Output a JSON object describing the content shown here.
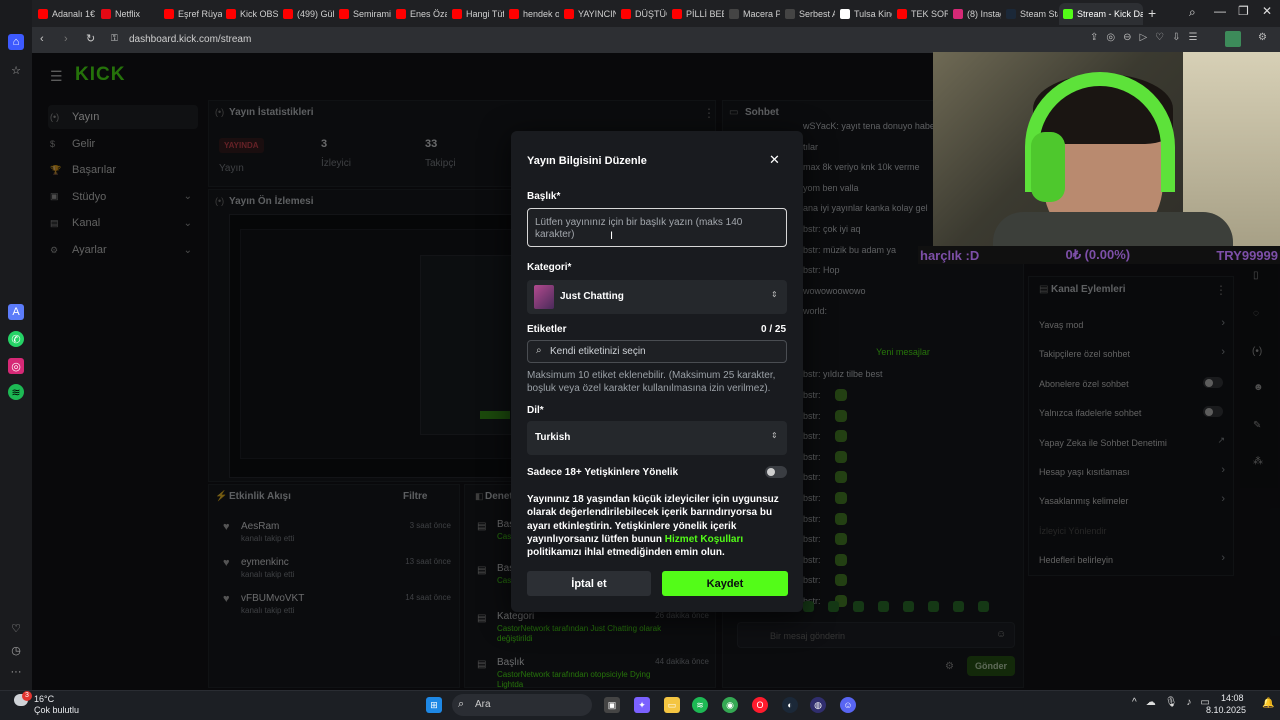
{
  "browser": {
    "tabs": [
      {
        "label": "Adanalı 1€",
        "color": "#ff0000"
      },
      {
        "label": "Netflix",
        "color": "#e50914"
      },
      {
        "label": "Eşref Rüya",
        "color": "#ff0000"
      },
      {
        "label": "Kick OBS",
        "color": "#ff0000"
      },
      {
        "label": "(499) Gülü",
        "color": "#ff0000"
      },
      {
        "label": "Semiramis",
        "color": "#ff0000"
      },
      {
        "label": "Enes Özay",
        "color": "#ff0000"
      },
      {
        "label": "Hangi Tüfe",
        "color": "#ff0000"
      },
      {
        "label": "hendek oy",
        "color": "#ff0000"
      },
      {
        "label": "YAYINCINI",
        "color": "#ff0000"
      },
      {
        "label": "DÜŞTÜĞÜ",
        "color": "#ff0000"
      },
      {
        "label": "PİLLİ BEBE",
        "color": "#ff0000"
      },
      {
        "label": "Macera Pe",
        "color": "#444444"
      },
      {
        "label": "Serbest At",
        "color": "#444444"
      },
      {
        "label": "Tulsa King",
        "color": "#ffffff"
      },
      {
        "label": "TEK SORU",
        "color": "#ff0000"
      },
      {
        "label": "(8) Instagr",
        "color": "#d62976"
      },
      {
        "label": "Steam Sta",
        "color": "#1b2838"
      },
      {
        "label": "Stream - Kick Da",
        "color": "#53fc18"
      }
    ],
    "url": "dashboard.kick.com/stream"
  },
  "app": {
    "logo": "KICK",
    "nav": [
      {
        "label": "Yayın",
        "active": true
      },
      {
        "label": "Gelir"
      },
      {
        "label": "Başarılar"
      },
      {
        "label": "Stüdyo",
        "chevron": true
      },
      {
        "label": "Kanal",
        "chevron": true
      },
      {
        "label": "Ayarlar",
        "chevron": true
      }
    ],
    "stats": {
      "title": "Yayın İstatistikleri",
      "badge": "YAYINDA",
      "badge_caption": "Yayın",
      "viewers_value": "3",
      "viewers_label": "İzleyici",
      "followers_value": "33",
      "followers_label": "Takipçi"
    },
    "preview_title": "Yayın Ön İzlemesi",
    "activity": {
      "title": "Etkinlik Akışı",
      "filter": "Filtre",
      "items": [
        {
          "name": "AesRam",
          "sub": "kanalı takip etti",
          "time": "3 saat önce"
        },
        {
          "name": "eymenkinc",
          "sub": "kanalı takip etti",
          "time": "13 saat önce"
        },
        {
          "name": "vFBUMvoVKT",
          "sub": "kanalı takip etti",
          "time": "14 saat önce"
        }
      ]
    },
    "events": {
      "title": "Denet",
      "items": [
        {
          "label": "Baş",
          "sub": "Cas"
        },
        {
          "label": "Baş",
          "sub": "Cas"
        },
        {
          "label": "Kategori",
          "sub": "CastorNetwork tarafından Just Chatting olarak değiştirildi",
          "time": "26 dakika önce"
        },
        {
          "label": "Başlık",
          "sub": "CastorNetwork tarafından otopsiciyle Dying Lightda",
          "time": "44 dakika önce"
        }
      ]
    },
    "chat": {
      "title": "Sohbet",
      "lines": [
        "wSYacK: yayıt tena donuyo haberin olsun",
        "tılar",
        "max 8k veriyo knk 10k verme",
        "yom ben valla",
        "ana iyi yayınlar kanka kolay gel",
        "bstr: çok iyi aq",
        "bstr: müzik bu adam ya",
        "bstr: Hop",
        "wowowoowowo",
        "world:"
      ],
      "new_messages": "Yeni mesajlar",
      "after": "bstr: yıldız tilbe best",
      "emote_lines": [
        "bstr:",
        "bstr:",
        "bstr:",
        "bstr:",
        "bstr:",
        "bstr:",
        "bstr:",
        "bstr:",
        "bstr:",
        "bstr:",
        "bstr:"
      ],
      "input_placeholder": "Bir mesaj gönderin",
      "send": "Gönder"
    },
    "channel_actions": {
      "title": "Kanal Eylemleri",
      "items": [
        {
          "label": "Yavaş mod",
          "type": "chevron"
        },
        {
          "label": "Takipçilere özel sohbet",
          "type": "chevron"
        },
        {
          "label": "Abonelere özel sohbet",
          "type": "toggle"
        },
        {
          "label": "Yalnızca ifadelerle sohbet",
          "type": "toggle"
        },
        {
          "label": "Yapay Zeka ile Sohbet Denetimi",
          "type": "external"
        },
        {
          "label": "Hesap yaşı kısıtlaması",
          "type": "chevron"
        },
        {
          "label": "Yasaklanmış kelimeler",
          "type": "chevron"
        },
        {
          "label": "İzleyici Yönlendir",
          "type": "disabled"
        },
        {
          "label": "Hedefleri belirleyin",
          "type": "chevron"
        }
      ]
    }
  },
  "modal": {
    "title": "Yayın Bilgisini Düzenle",
    "title_label": "Başlık*",
    "title_placeholder": "Lütfen yayınınız için bir başlık yazın (maks 140 karakter)",
    "category_label": "Kategori*",
    "category_value": "Just Chatting",
    "tags_label": "Etiketler",
    "tags_count": "0 / 25",
    "tags_placeholder": "Kendi etiketinizi seçin",
    "tags_hint": "Maksimum 10 etiket eklenebilir. (Maksimum 25 karakter, boşluk veya özel karakter kullanılmasına izin verilmez).",
    "lang_label": "Dil*",
    "lang_value": "Turkish",
    "adult_label": "Sadece 18+ Yetişkinlere Yönelik",
    "adult_text_1": "Yayınınız 18 yaşından küçük izleyiciler için uygunsuz olarak değerlendirilebilecek içerik barındırıyorsa bu ayarı etkinleştirin. Yetişkinlere yönelik içerik yayınlıyorsanız lütfen bunun ",
    "adult_link": "Hizmet Koşulları",
    "adult_text_2": " politikamızı ihlal etmediğinden emin olun.",
    "cancel": "İptal et",
    "save": "Kaydet"
  },
  "overlay": {
    "ticker_left": "harçlık :D",
    "ticker_mid": "0₺ (0.00%)",
    "ticker_right": "TRY99999"
  },
  "taskbar": {
    "weather_temp": "16°C",
    "weather_desc": "Çok bulutlu",
    "search": "Ara",
    "time": "14:08",
    "date": "8.10.2025",
    "badge": "3"
  },
  "colors": {
    "accent": "#53fc18",
    "bg": "#0b0e11",
    "panel": "#191b1f"
  }
}
